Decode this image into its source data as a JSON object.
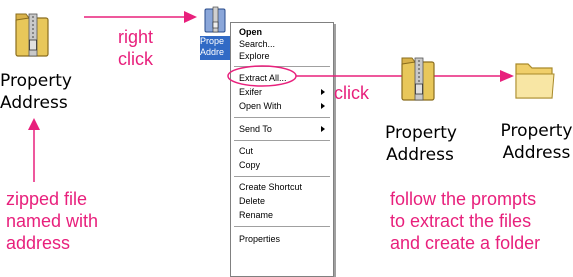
{
  "icons": {
    "zipped_label_line1": "Property",
    "zipped_label_line2": "Address",
    "extracted_zip_label_line1": "Property",
    "extracted_zip_label_line2": "Address",
    "folder_label_line1": "Property",
    "folder_label_line2": "Address",
    "selected_caption_line1": "Prope",
    "selected_caption_line2": "Addre"
  },
  "annotations": {
    "right_click_line1": "right",
    "right_click_line2": "click",
    "click": "click",
    "zipped_note_line1": "zipped file",
    "zipped_note_line2": "named with",
    "zipped_note_line3": "address",
    "follow_line1": "follow the prompts",
    "follow_line2": "to extract the files",
    "follow_line3": "and create a folder"
  },
  "context_menu": {
    "items": [
      {
        "label": "Open",
        "bold": true
      },
      {
        "label": "Search..."
      },
      {
        "label": "Explore"
      },
      {
        "label": "Extract All..."
      },
      {
        "label": "Exifer",
        "submenu": true
      },
      {
        "label": "Open With",
        "submenu": true
      },
      {
        "label": "Send To",
        "submenu": true
      },
      {
        "label": "Cut"
      },
      {
        "label": "Copy"
      },
      {
        "label": "Create Shortcut"
      },
      {
        "label": "Delete"
      },
      {
        "label": "Rename"
      },
      {
        "label": "Properties"
      }
    ]
  },
  "colors": {
    "annotation": "#e8207c",
    "selection": "#316ac5",
    "folder_yellow": "#f5d77a"
  }
}
